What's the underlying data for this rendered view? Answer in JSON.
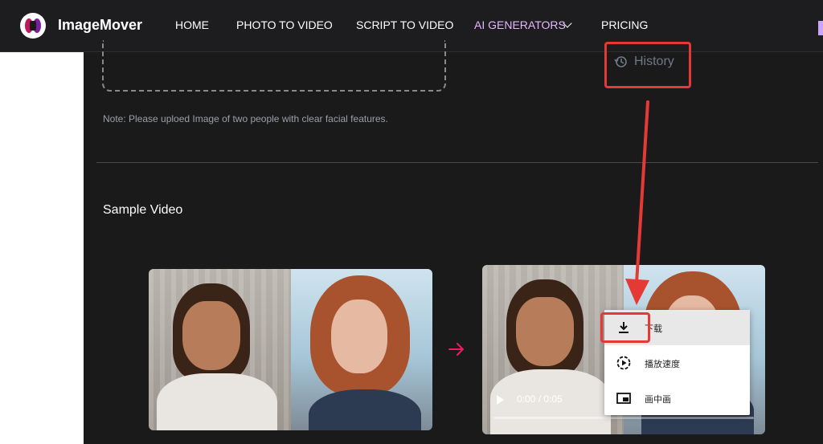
{
  "brand": {
    "name": "ImageMover"
  },
  "nav": {
    "home": "HOME",
    "photo_to_video": "PHOTO TO VIDEO",
    "script_to_video": "SCRIPT TO VIDEO",
    "ai_generators": "AI GENERATORS",
    "pricing": "PRICING"
  },
  "history": {
    "label": "History",
    "icon": "history-icon"
  },
  "note": "Note: Please uploed Image of two people with clear facial features.",
  "sample": {
    "title": "Sample Video"
  },
  "video": {
    "time": "0:00 / 0:05"
  },
  "context_menu": {
    "items": [
      {
        "label": "下载",
        "icon": "download-icon"
      },
      {
        "label": "播放速度",
        "icon": "playback-speed-icon"
      },
      {
        "label": "画中画",
        "icon": "picture-in-picture-icon"
      }
    ]
  },
  "colors": {
    "accent_nav": "#e3b8ff",
    "annotation_red": "#e53935",
    "arrow_pink": "#e91e63"
  }
}
